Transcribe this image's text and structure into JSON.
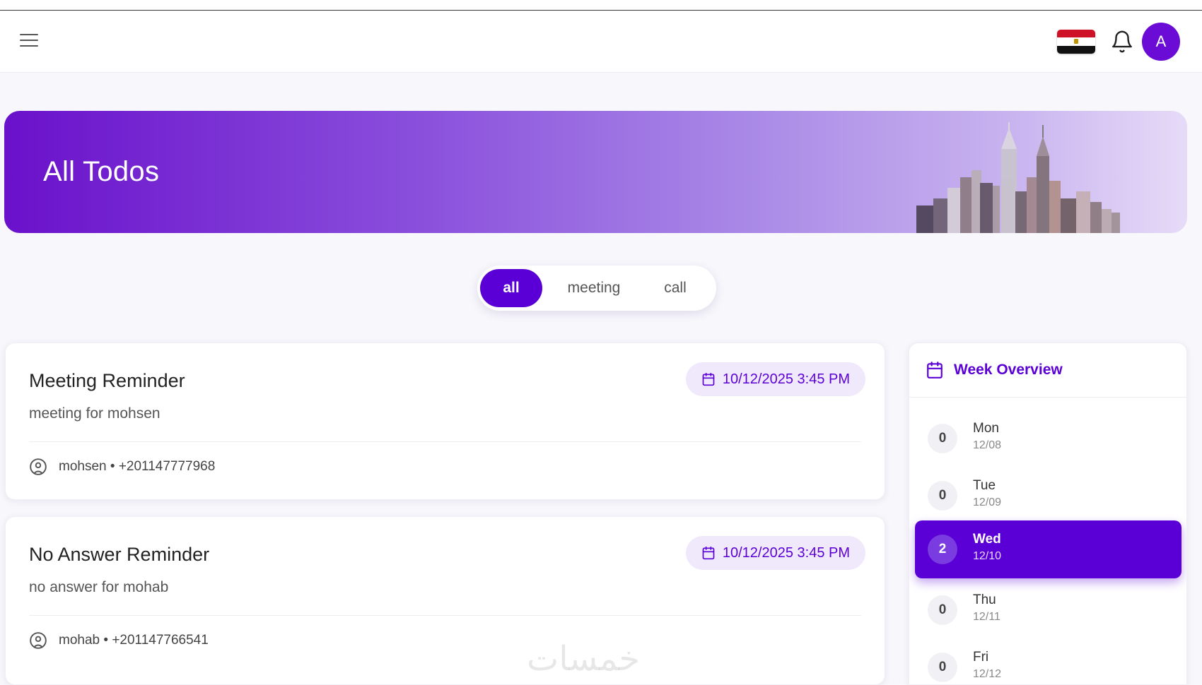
{
  "header": {
    "avatar_initial": "A",
    "icons": {
      "menu": "menu-icon",
      "bell": "bell-icon",
      "flag": "egypt-flag"
    }
  },
  "hero": {
    "title": "All Todos"
  },
  "filters": {
    "all": "all",
    "meeting": "meeting",
    "call": "call",
    "active": "all"
  },
  "todos": [
    {
      "title": "Meeting Reminder",
      "description": "meeting for mohsen",
      "datetime": "10/12/2025 3:45 PM",
      "contact_name": "mohsen",
      "contact_phone": "+201147777968"
    },
    {
      "title": "No Answer Reminder",
      "description": "no answer for mohab",
      "datetime": "10/12/2025 3:45 PM",
      "contact_name": "mohab",
      "contact_phone": "+201147766541"
    }
  ],
  "week": {
    "title": "Week Overview",
    "days": [
      {
        "count": "0",
        "name": "Mon",
        "date": "12/08",
        "active": false
      },
      {
        "count": "0",
        "name": "Tue",
        "date": "12/09",
        "active": false
      },
      {
        "count": "2",
        "name": "Wed",
        "date": "12/10",
        "active": true
      },
      {
        "count": "0",
        "name": "Thu",
        "date": "12/11",
        "active": false
      },
      {
        "count": "0",
        "name": "Fri",
        "date": "12/12",
        "active": false
      }
    ]
  },
  "watermark": "خمسات",
  "colors": {
    "accent": "#5a00d6",
    "background": "#f8f7fc",
    "badge_bg": "#f0e9fc"
  }
}
